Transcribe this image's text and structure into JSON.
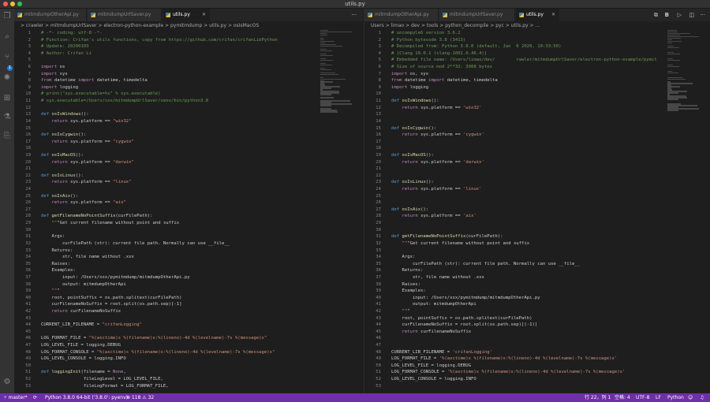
{
  "window": {
    "title": "utils.py"
  },
  "left": {
    "tabs": [
      {
        "label": "mitmdumpOtherApi.py",
        "active": false
      },
      {
        "label": "mitmdumpUrlSaver.py",
        "active": false
      },
      {
        "label": "utils.py",
        "active": true
      }
    ],
    "breadcrumb": "> crawler > mitmdumpUrlSaver > electron-python-example > pymitmdump > utils.py > osIsMacOS",
    "lines": [
      "# -*- coding: utf-8 -*-",
      "# Function: Crifan's utils functions, copy from https://github.com/crifan/crifanLibPython",
      "# Update: 20200103",
      "# Author: Crifan Li",
      "",
      "import os",
      "import sys",
      "from datetime import datetime, timedelta",
      "import logging",
      "# print(\"sys.executable=%s\" % sys.executable)",
      "# sys.executable=/Users/xxx/mitmdumpUrlSaver/venv/bin/python3.8",
      "",
      "def osIsWindows():",
      "    return sys.platform == \"win32\"",
      "",
      "def osIsCygwin():",
      "    return sys.platform == \"cygwin\"",
      "",
      "def osIsMacOS():",
      "    return sys.platform == \"darwin\"",
      "",
      "def osIsLinux():",
      "    return sys.platform == \"linux\"",
      "",
      "def osIsAix():",
      "    return sys.platform == \"aix\"",
      "",
      "def getFilenameNoPointSuffix(curFilePath):",
      "    \"\"\"Get current filename without point and suffix",
      "",
      "    Args:",
      "        curFilePath (str): current file path. Normally can use __file__",
      "    Returns:",
      "        str, file name without .xxx",
      "    Raises:",
      "    Examples:",
      "        input: /Users/xxx/pymitmdump/mitmdumpOtherApi.py",
      "        output: mitmdumpOtherApi",
      "    \"\"\"",
      "    root, pointSuffix = os.path.splitext(curFilePath)",
      "    curFilenameNoSuffix = root.split(os.path.sep)[-1]",
      "    return curFilenameNoSuffix",
      "",
      "CURRENT_LIB_FILENAME = \"crifanLogging\"",
      "",
      "LOG_FORMAT_FILE = \"%(asctime)s %(filename)s:%(lineno)-4d %(levelname)-7s %(message)s\"",
      "LOG_LEVEL_FILE = logging.DEBUG",
      "LOG_FORMAT_CONSOLE = \"%(asctime)s %(filename)s:%(lineno)-4d %(levelname)-7s %(message)s\"",
      "LOG_LEVEL_CONSOLE = logging.INFO",
      "",
      "def loggingInit(filename = None,",
      "                fileLogLevel = LOG_LEVEL_FILE,",
      "                fileLogFormat = LOG_FORMAT_FILE,"
    ]
  },
  "right": {
    "tabs": [
      {
        "label": "mitmdumpOtherApi.py",
        "active": false
      },
      {
        "label": "mitmdumpUrlSaver.py",
        "active": false
      },
      {
        "label": "utils.py",
        "active": true
      }
    ],
    "breadcrumb": "Users > limao > dev > tools > python_decompile > pyc > utils.py > ...",
    "lines": [
      "# uncompyle6 version 3.6.2",
      "# Python bytecode 3.8 (3413)",
      "# Decompiled from: Python 3.8.0 (default, Jan  6 2020, 10:33:50)",
      "# [Clang 10.0.1 (clang-1001.0.46.4)]",
      "# Embedded file name: /Users/limao/dev/        rawler/mitmdumpUrlSaver/electron-python-example/pymit",
      "# Size of source mod 2**32: 3908 bytes",
      "import os, sys",
      "from datetime import datetime, timedelta",
      "import logging",
      "",
      "def osIsWindows():",
      "    return sys.platform == 'win32'",
      "",
      "",
      "def osIsCygwin():",
      "    return sys.platform == 'cygwin'",
      "",
      "",
      "def osIsMacOS():",
      "    return sys.platform == 'darwin'",
      "",
      "",
      "def osIsLinux():",
      "    return sys.platform == 'linux'",
      "",
      "",
      "def osIsAix():",
      "    return sys.platform == 'aix'",
      "",
      "",
      "def getFilenameNoPointSuffix(curFilePath):",
      "    \"\"\"Get current filename without point and suffix",
      "",
      "    Args:",
      "        curFilePath (str): current file path. Normally can use __file__",
      "    Returns:",
      "        str, file name without .xxx",
      "    Raises:",
      "    Examples:",
      "        input: /Users/xxx/pymitmdump/mitmdumpOtherApi.py",
      "        output: mitmdumpOtherApi",
      "    \"\"\"",
      "    root, pointSuffix = os.path.splitext(curFilePath)",
      "    curFilenameNoSuffix = root.split(os.path.sep)[(-1)]",
      "    return curFilenameNoSuffix",
      "",
      "",
      "CURRENT_LIB_FILENAME = 'crifanLogging'",
      "LOG_FORMAT_FILE = '%(asctime)s %(filename)s:%(lineno)-4d %(levelname)-7s %(message)s'",
      "LOG_LEVEL_FILE = logging.DEBUG",
      "LOG_FORMAT_CONSOLE = '%(asctime)s %(filename)s:%(lineno)-4d %(levelname)-7s %(message)s'",
      "LOG_LEVEL_CONSOLE = logging.INFO",
      ""
    ]
  },
  "status": {
    "branch": "master*",
    "interpreter": "Python 3.8.0 64-bit ('3.8.0': pyenv)",
    "problems": "⊗ 118 ⚠ 32",
    "position": "行 22，列 1",
    "spaces": "空格: 4",
    "encoding": "UTF-8",
    "eol": "LF",
    "language": "Python",
    "bg_color": "#6f2fa8"
  },
  "icons": [
    "explorer-icon",
    "search-icon",
    "source-control-icon",
    "debug-icon",
    "extensions-icon",
    "flask-icon",
    "remote-icon",
    "settings-icon"
  ]
}
